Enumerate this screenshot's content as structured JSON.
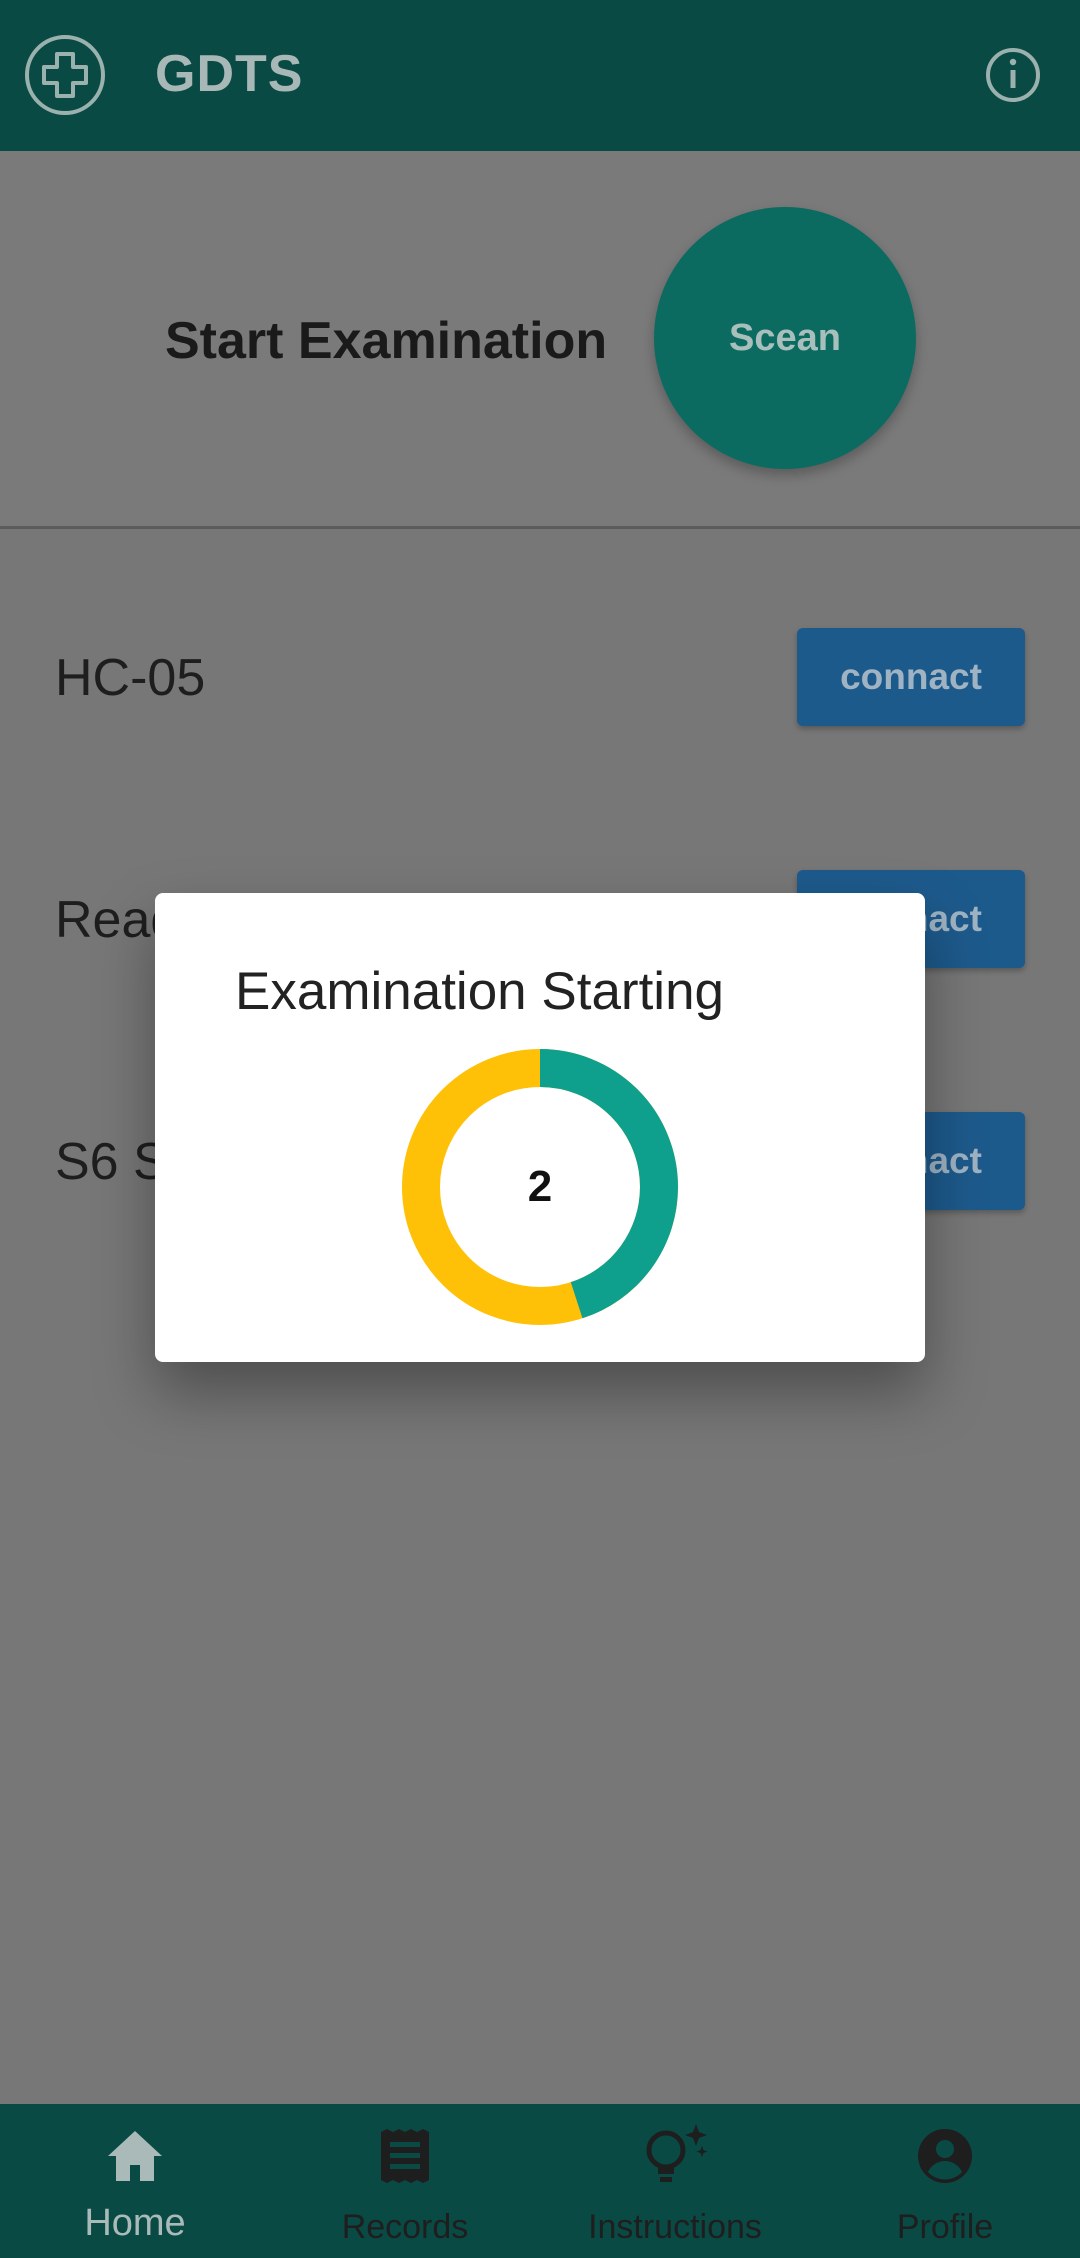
{
  "app": {
    "title": "GDTS"
  },
  "exam": {
    "title": "Start Examination",
    "scan_label": "Scean"
  },
  "devices": [
    {
      "name": "HC-05",
      "connect_label": "connact"
    },
    {
      "name": "Read",
      "connect_label": "connact"
    },
    {
      "name": "S6 S",
      "connect_label": "connact"
    }
  ],
  "dialog": {
    "title": "Examination Starting",
    "countdown": "2",
    "progress_fraction": 0.45,
    "colors": {
      "elapsed": "#0ea08c",
      "remaining": "#ffc107"
    }
  },
  "nav": {
    "items": [
      {
        "label": "Home",
        "icon": "home-icon",
        "active": true
      },
      {
        "label": "Records",
        "icon": "receipt-icon",
        "active": false
      },
      {
        "label": "Instructions",
        "icon": "lightbulb-icon",
        "active": false
      },
      {
        "label": "Profile",
        "icon": "account-circle-icon",
        "active": false
      }
    ]
  }
}
